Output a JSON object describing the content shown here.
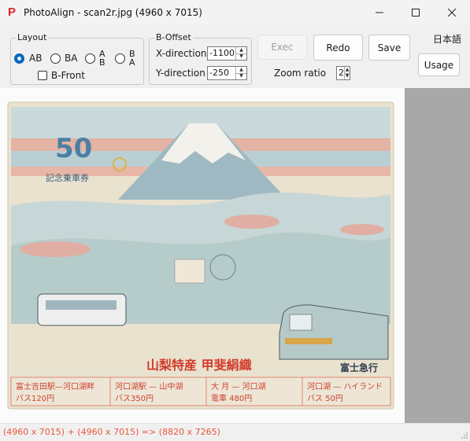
{
  "window": {
    "app_icon_glyph": "P",
    "title": "PhotoAlign - scan2r.jpg (4960 x 7015)",
    "icon_color": "#e0202e"
  },
  "layout_group": {
    "label": "Layout",
    "options": [
      {
        "label": "AB",
        "checked": true
      },
      {
        "label": "BA",
        "checked": false
      },
      {
        "label_top": "A",
        "label_bottom": "B",
        "checked": false
      },
      {
        "label_top": "B",
        "label_bottom": "A",
        "checked": false
      }
    ],
    "b_front_label": "B-Front",
    "b_front_checked": false
  },
  "offset_group": {
    "label": "B-Offset",
    "x_label": "X-direction",
    "x_value": "-1100",
    "y_label": "Y-direction",
    "y_value": "-250"
  },
  "buttons": {
    "exec": "Exec",
    "redo": "Redo",
    "save": "Save",
    "usage": "Usage"
  },
  "language_label": "日本語",
  "zoom": {
    "label": "Zoom ratio",
    "value": "2"
  },
  "status": {
    "text": "(4960 x 7015) + (4960 x 7015) => (8820 x 7265)",
    "color": "#e8583c"
  },
  "preview": {
    "japanese_logo": "富士急行",
    "anniversary": "50",
    "commemorative": "記念乗車券",
    "banner": "山梨特産 甲斐絹織",
    "table_cells": [
      "富士吉田駅—河口湖畔",
      "バス120円",
      "河口湖駅 — 山中湖",
      "バス350円",
      "大 月 — 河口湖",
      "電車 480円",
      "河口湖 — ハイランド",
      "バス 50円"
    ]
  }
}
